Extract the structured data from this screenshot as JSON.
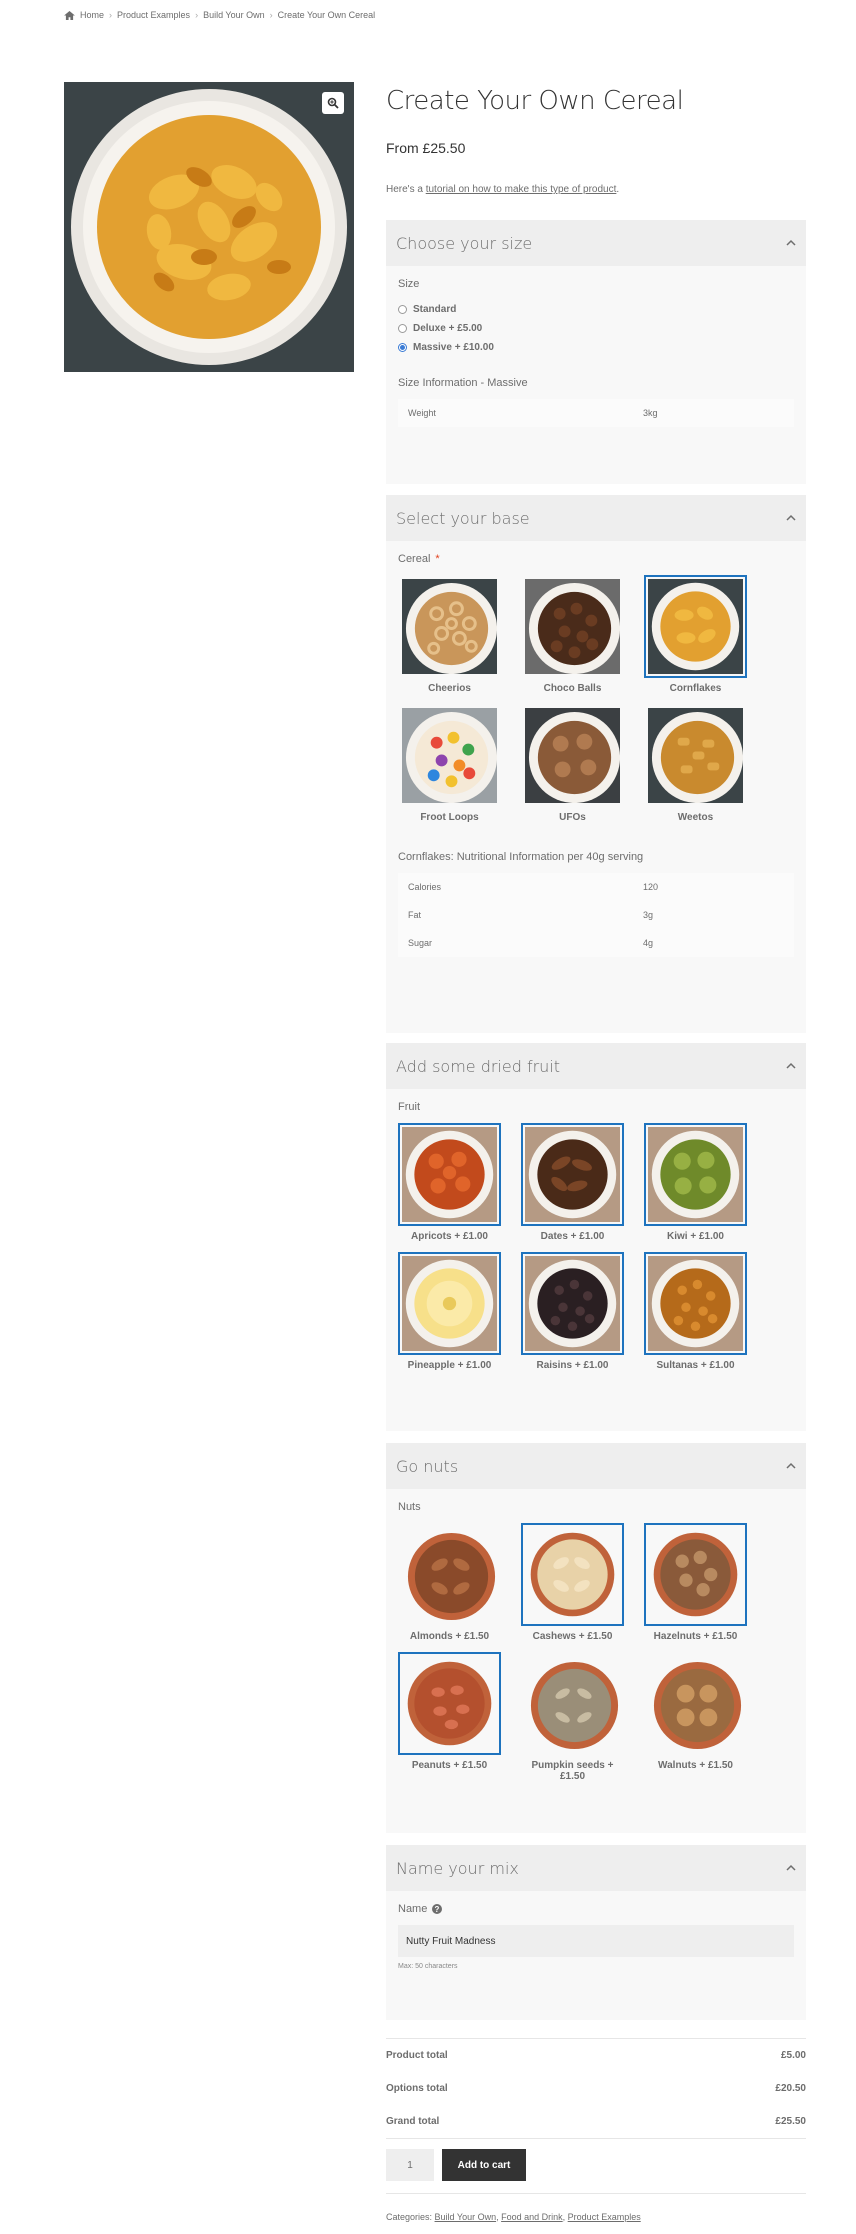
{
  "breadcrumb": {
    "items": [
      "Home",
      "Product Examples",
      "Build Your Own",
      "Create Your Own Cereal"
    ]
  },
  "icons": {
    "home": "home-icon",
    "zoom": "zoom-icon",
    "collapse": "chevron-up-icon",
    "help": "help-icon"
  },
  "colors": {
    "selection": "#1e73be",
    "panel_head": "#eeeeee",
    "button": "#333333",
    "required": "#e2401c"
  },
  "product": {
    "title": "Create Your Own Cereal",
    "price": "From £25.50",
    "tutorial_prefix": "Here's a ",
    "tutorial_link": "tutorial on how to make this type of product",
    "tutorial_suffix": "."
  },
  "size_panel": {
    "title": "Choose your size",
    "label": "Size",
    "options": [
      {
        "label": "Standard",
        "checked": false
      },
      {
        "label": "Deluxe + £5.00",
        "checked": false
      },
      {
        "label": "Massive + £10.00",
        "checked": true
      }
    ],
    "info_title": "Size Information - Massive",
    "info": [
      {
        "k": "Weight",
        "v": "3kg"
      }
    ]
  },
  "base_panel": {
    "title": "Select your base",
    "label": "Cereal",
    "required_mark": "*",
    "items": [
      {
        "label": "Cheerios",
        "selected": false
      },
      {
        "label": "Choco Balls",
        "selected": false
      },
      {
        "label": "Cornflakes",
        "selected": true
      },
      {
        "label": "Froot Loops",
        "selected": false
      },
      {
        "label": "UFOs",
        "selected": false
      },
      {
        "label": "Weetos",
        "selected": false
      }
    ],
    "info_title": "Cornflakes: Nutritional Information per 40g serving",
    "info": [
      {
        "k": "Calories",
        "v": "120"
      },
      {
        "k": "Fat",
        "v": "3g"
      },
      {
        "k": "Sugar",
        "v": "4g"
      }
    ]
  },
  "fruit_panel": {
    "title": "Add some dried fruit",
    "label": "Fruit",
    "items": [
      {
        "label": "Apricots + £1.00",
        "selected": true
      },
      {
        "label": "Dates + £1.00",
        "selected": true
      },
      {
        "label": "Kiwi + £1.00",
        "selected": true
      },
      {
        "label": "Pineapple + £1.00",
        "selected": true
      },
      {
        "label": "Raisins + £1.00",
        "selected": true
      },
      {
        "label": "Sultanas + £1.00",
        "selected": true
      }
    ]
  },
  "nuts_panel": {
    "title": "Go nuts",
    "label": "Nuts",
    "items": [
      {
        "label": "Almonds + £1.50",
        "selected": false
      },
      {
        "label": "Cashews + £1.50",
        "selected": true
      },
      {
        "label": "Hazelnuts + £1.50",
        "selected": true
      },
      {
        "label": "Peanuts + £1.50",
        "selected": true
      },
      {
        "label": "Pumpkin seeds + £1.50",
        "selected": false
      },
      {
        "label": "Walnuts + £1.50",
        "selected": false
      }
    ]
  },
  "name_panel": {
    "title": "Name your mix",
    "label": "Name",
    "value": "Nutty Fruit Madness",
    "hint": "Max: 50 characters"
  },
  "totals": [
    {
      "label": "Product total",
      "value": "£5.00"
    },
    {
      "label": "Options total",
      "value": "£20.50"
    },
    {
      "label": "Grand total",
      "value": "£25.50"
    }
  ],
  "cart": {
    "quantity": "1",
    "add_label": "Add to cart"
  },
  "categories": {
    "prefix": "Categories:",
    "items": [
      "Build Your Own",
      "Food and Drink",
      "Product Examples"
    ]
  }
}
